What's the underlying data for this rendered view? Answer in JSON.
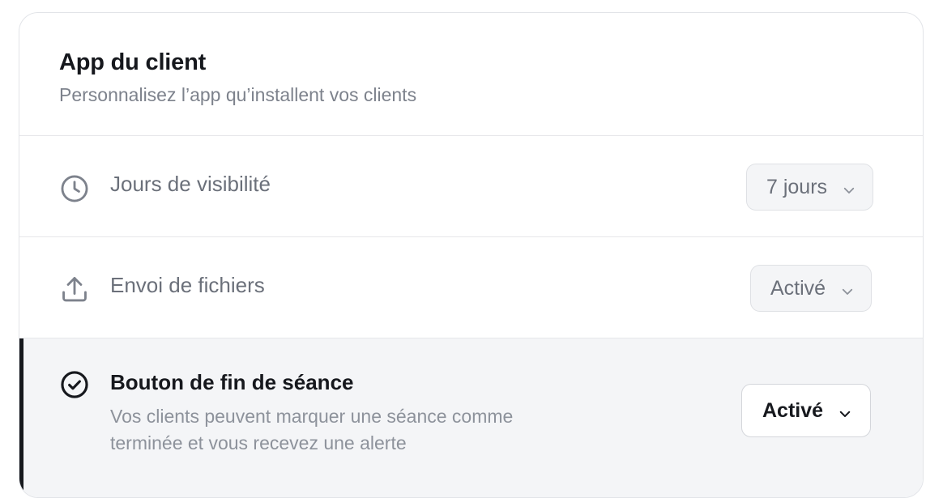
{
  "header": {
    "title": "App du client",
    "subtitle": "Personnalisez l’app qu’installent vos clients"
  },
  "settings": [
    {
      "icon": "clock-icon",
      "label": "Jours de visibilité",
      "value": "7 jours"
    },
    {
      "icon": "upload-icon",
      "label": "Envoi de fichiers",
      "value": "Activé"
    },
    {
      "icon": "check-circle-icon",
      "label": "Bouton de fin de séance",
      "description_line1": "Vos clients peuvent marquer une séance comme",
      "description_line2": "terminée et vous recevez une alerte",
      "value": "Activé",
      "selected": true
    }
  ],
  "colors": {
    "text_primary": "#16181d",
    "text_muted": "#7d828c",
    "selected_row_bg": "#f4f5f7",
    "selected_accent": "#16181d",
    "border": "#e6e7ea"
  }
}
